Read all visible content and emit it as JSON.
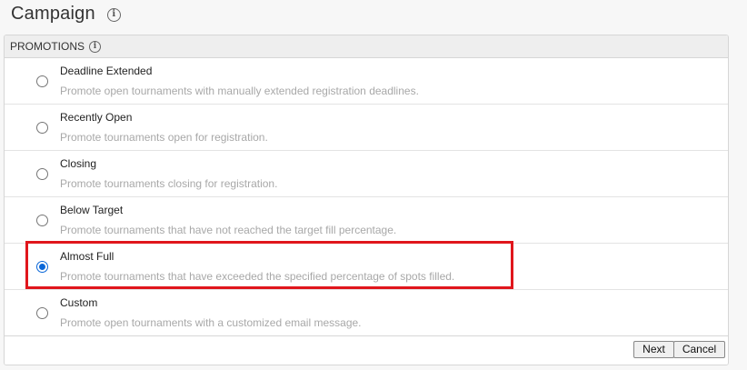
{
  "header": {
    "title": "Campaign",
    "info_icon": "info-icon"
  },
  "panel": {
    "title": "PROMOTIONS",
    "info_icon": "info-icon"
  },
  "options": [
    {
      "label": "Deadline Extended",
      "description": "Promote open tournaments with manually extended registration deadlines.",
      "selected": false
    },
    {
      "label": "Recently Open",
      "description": "Promote tournaments open for registration.",
      "selected": false
    },
    {
      "label": "Closing",
      "description": "Promote tournaments closing for registration.",
      "selected": false
    },
    {
      "label": "Below Target",
      "description": "Promote tournaments that have not reached the target fill percentage.",
      "selected": false
    },
    {
      "label": "Almost Full",
      "description": "Promote tournaments that have exceeded the specified percentage of spots filled.",
      "selected": true
    },
    {
      "label": "Custom",
      "description": "Promote open tournaments with a customized email message.",
      "selected": false
    }
  ],
  "footer": {
    "next_label": "Next",
    "cancel_label": "Cancel"
  },
  "colors": {
    "highlight": "#e0161c",
    "radio_selected": "#0a67d8",
    "description_text": "#a8a8a8"
  }
}
